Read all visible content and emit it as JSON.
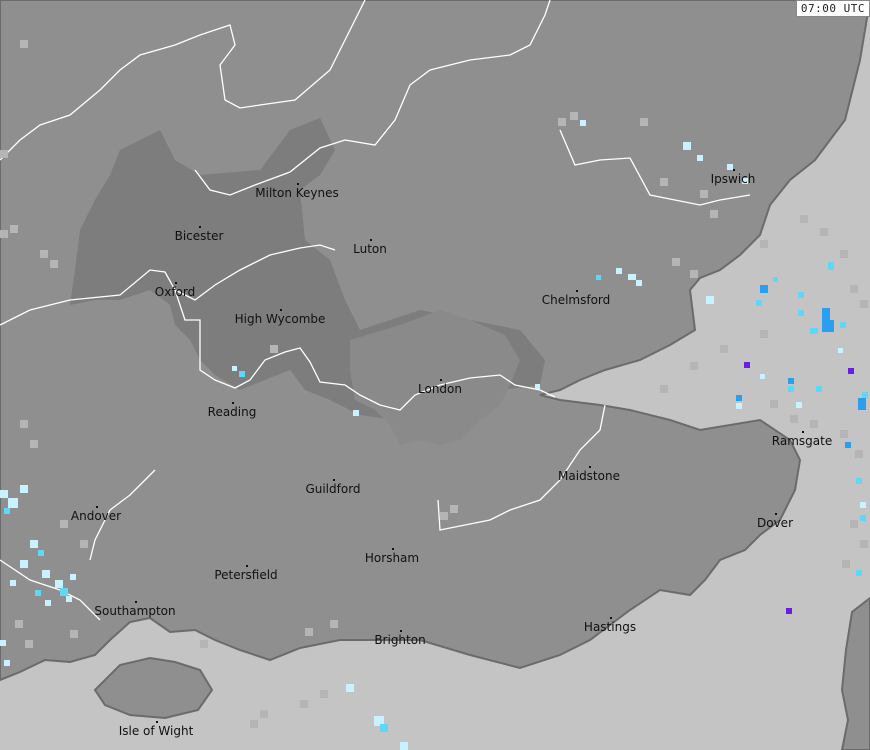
{
  "timestamp": "07:00 UTC",
  "colors": {
    "sea": "#c4c4c4",
    "land": "#8f8f8f",
    "region": "#7d7d7d",
    "border": "#6b6b6b",
    "boundary": "#ffffff",
    "radar_light": "#c8f2ff",
    "radar_mid": "#5fd7f5",
    "radar_blue": "#2a9ff0",
    "radar_purple": "#6a1ee0"
  },
  "places": [
    {
      "name": "Milton Keynes"
    },
    {
      "name": "Ipswich"
    },
    {
      "name": "Bicester"
    },
    {
      "name": "Luton"
    },
    {
      "name": "Oxford"
    },
    {
      "name": "Chelmsford"
    },
    {
      "name": "High Wycombe"
    },
    {
      "name": "London"
    },
    {
      "name": "Reading"
    },
    {
      "name": "Ramsgate"
    },
    {
      "name": "Maidstone"
    },
    {
      "name": "Guildford"
    },
    {
      "name": "Andover"
    },
    {
      "name": "Dover"
    },
    {
      "name": "Horsham"
    },
    {
      "name": "Petersfield"
    },
    {
      "name": "Southampton"
    },
    {
      "name": "Hastings"
    },
    {
      "name": "Brighton"
    },
    {
      "name": "Isle of Wight"
    }
  ]
}
